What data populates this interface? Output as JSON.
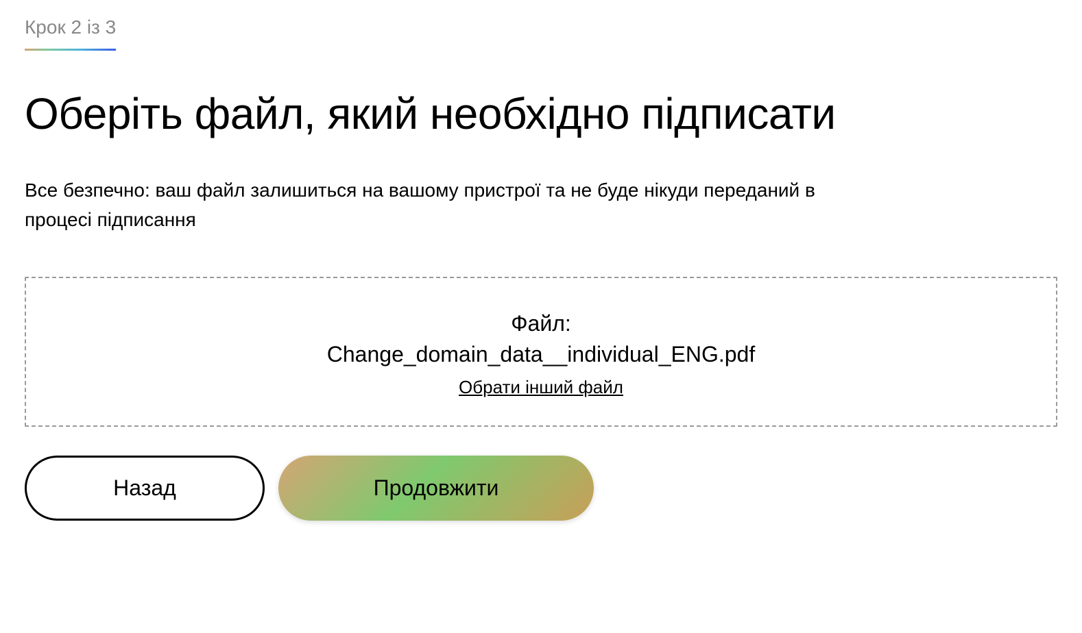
{
  "step": {
    "label": "Крок 2 із 3"
  },
  "title": "Оберіть файл, який необхідно підписати",
  "description": "Все безпечно: ваш файл залишиться на вашому пристрої та не буде нікуди переданий в процесі підписання",
  "file": {
    "label": "Файл:",
    "name": "Change_domain_data__individual_ENG.pdf",
    "choose_another": "Обрати інший файл"
  },
  "buttons": {
    "back": "Назад",
    "continue": "Продовжити"
  }
}
